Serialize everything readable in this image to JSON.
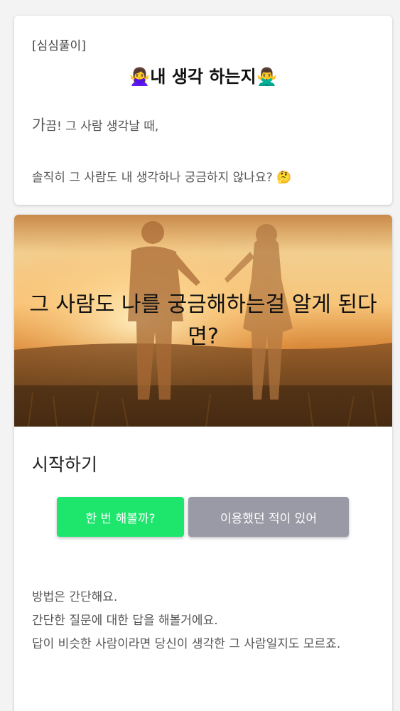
{
  "intro_card": {
    "tag": "[심심풀이]",
    "title": "내 생각 하는지",
    "title_emoji_left": "🙅‍♀️",
    "title_emoji_right": "🙅‍♂️",
    "line1_first": "가",
    "line1_rest": "끔! 그 사람 생각날 때,",
    "line2": "솔직히 그 사람도 내 생각하나 궁금하지 않나요? 🤔"
  },
  "hero": {
    "text": "그 사람도 나를 궁금해하는걸 알게 된다면?"
  },
  "start": {
    "label": "시작하기",
    "try_button": "한 번 해볼까?",
    "used_button": "이용했던 적이 있어"
  },
  "description": {
    "lines": [
      "방법은 간단해요.",
      "간단한 질문에 대한 답을 해볼거에요.",
      "답이 비슷한 사람이라면 당신이 생각한 그 사람일지도 모르죠."
    ]
  },
  "colors": {
    "try_button": "#1ee66d",
    "used_button": "#9a9aa6",
    "hero_sky": "#f3c27a",
    "hero_ground": "#5a3a1c"
  }
}
